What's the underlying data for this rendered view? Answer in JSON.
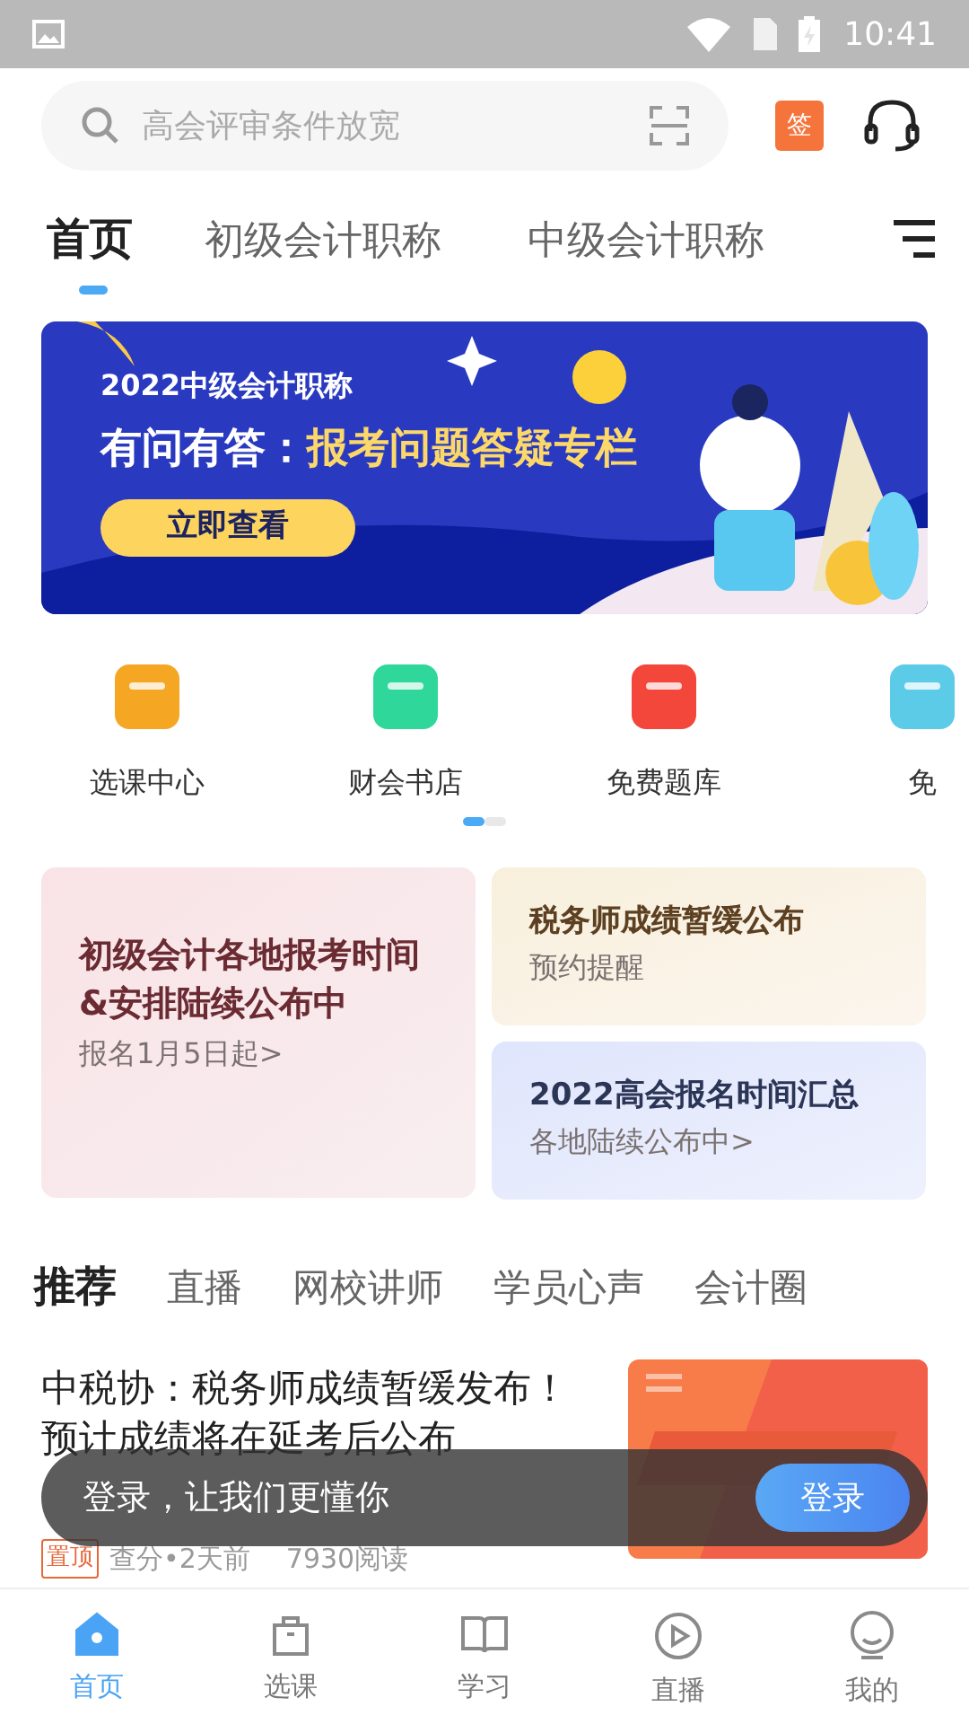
{
  "status_bar": {
    "time": "10:41"
  },
  "search": {
    "placeholder": "高会评审条件放宽"
  },
  "sign_badge": "签",
  "top_tabs": [
    {
      "label": "首页",
      "selected": true
    },
    {
      "label": "初级会计职称",
      "selected": false
    },
    {
      "label": "中级会计职称",
      "selected": false
    }
  ],
  "banner": {
    "subtitle": "2022中级会计职称",
    "title_lead": "有问有答：",
    "title_highlight": "报考问题答疑专栏",
    "button": "立即查看"
  },
  "shortcuts": [
    {
      "label": "选课中心",
      "color": "#f5a623"
    },
    {
      "label": "财会书店",
      "color": "#2fd89a"
    },
    {
      "label": "免费题库",
      "color": "#f2473a"
    },
    {
      "label": "免",
      "color": "#5ccbe8"
    }
  ],
  "pager": [
    {
      "selected": true
    },
    {
      "selected": false
    }
  ],
  "promo_cards": [
    {
      "title": "初级会计各地报考时间&安排陆续公布中",
      "subtitle": "报名1月5日起>",
      "kind": "pink"
    },
    {
      "title": "税务师成绩暂缓公布",
      "subtitle": "预约提醒",
      "kind": "cream"
    },
    {
      "title": "2022高会报名时间汇总",
      "subtitle": "各地陆续公布中>",
      "kind": "blue"
    }
  ],
  "feed_tabs": [
    {
      "label": "推荐",
      "selected": true
    },
    {
      "label": "直播",
      "selected": false
    },
    {
      "label": "网校讲师",
      "selected": false
    },
    {
      "label": "学员心声",
      "selected": false
    },
    {
      "label": "会计圈",
      "selected": false
    }
  ],
  "article": {
    "title": "中税协：税务师成绩暂缓发布！预计成绩将在延考后公布",
    "tag": "置顶",
    "meta": "查分•2天前",
    "reads": "7930阅读"
  },
  "login_toast": {
    "message": "登录，让我们更懂你",
    "button": "登录"
  },
  "bottom_nav": [
    {
      "label": "首页",
      "selected": true
    },
    {
      "label": "选课",
      "selected": false
    },
    {
      "label": "学习",
      "selected": false
    },
    {
      "label": "直播",
      "selected": false
    },
    {
      "label": "我的",
      "selected": false
    }
  ]
}
